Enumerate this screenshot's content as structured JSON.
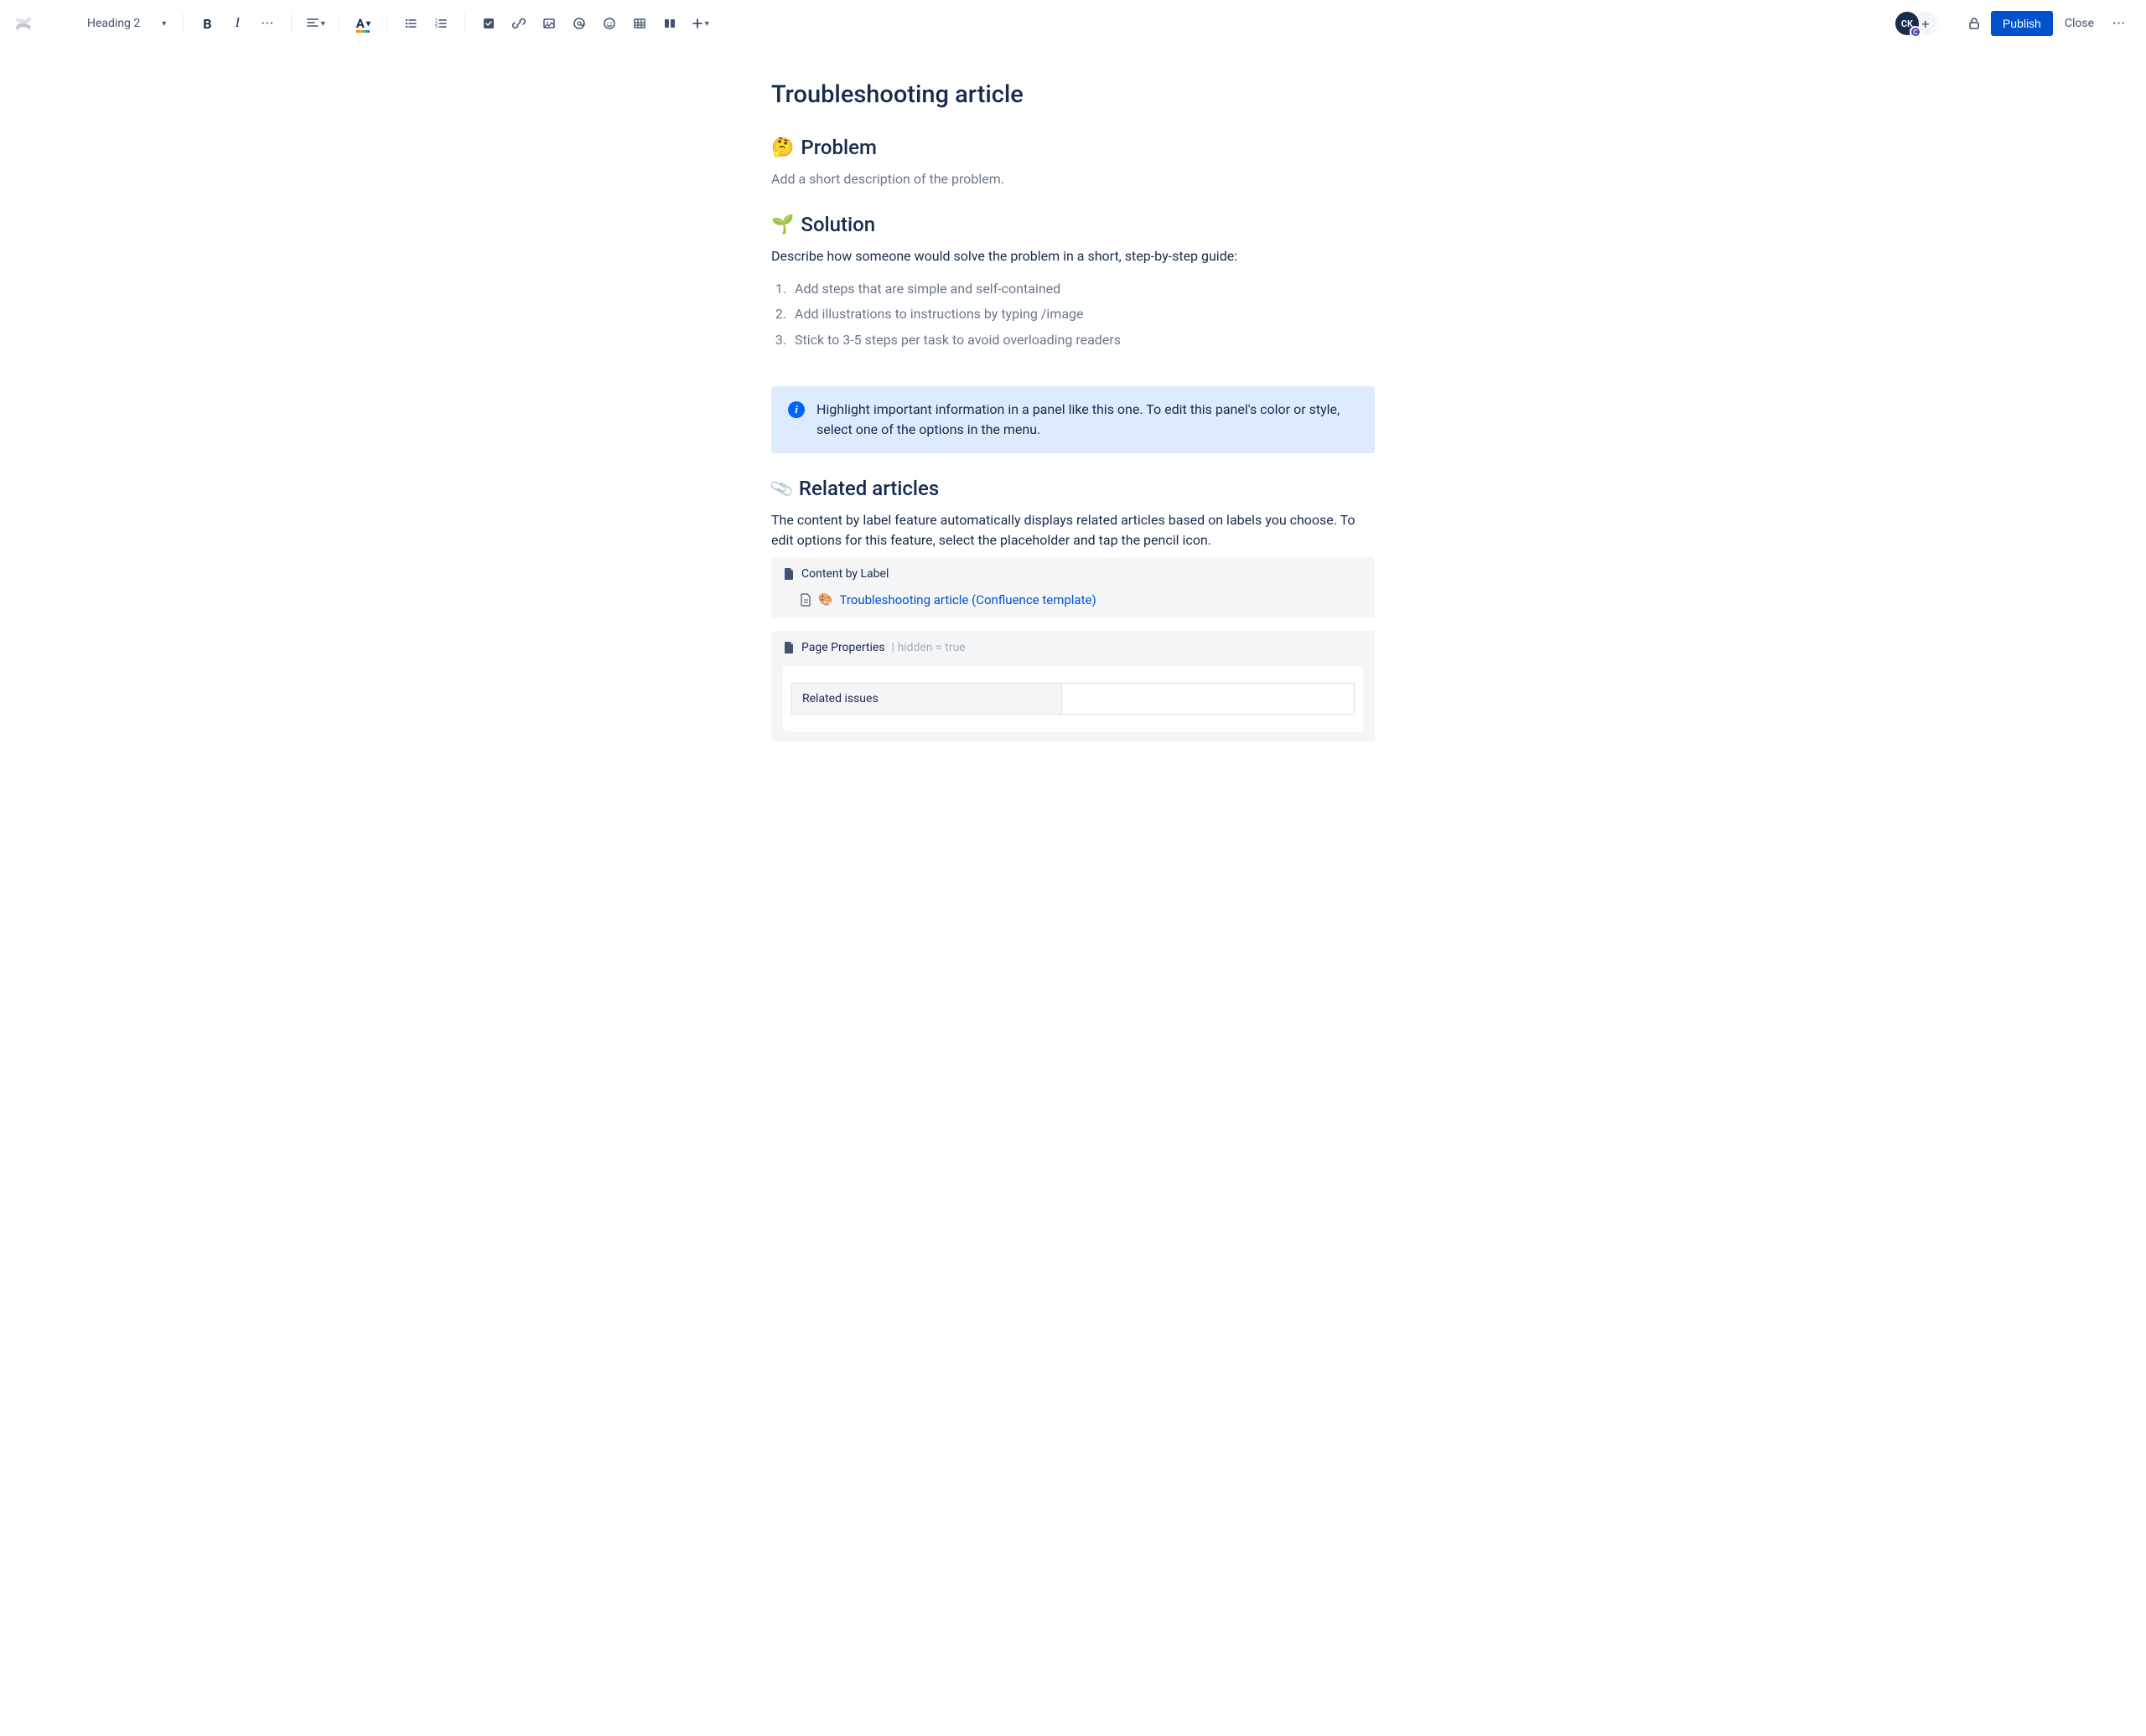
{
  "toolbar": {
    "heading_style": "Heading 2",
    "publish_label": "Publish",
    "close_label": "Close"
  },
  "user": {
    "initials": "CK",
    "badge": "C"
  },
  "page": {
    "title": "Troubleshooting article"
  },
  "sections": {
    "problem": {
      "emoji": "🤔",
      "heading": "Problem",
      "placeholder": "Add a short description of the problem."
    },
    "solution": {
      "emoji": "🌱",
      "heading": "Solution",
      "intro": "Describe how someone would solve the problem in a short, step-by-step guide:",
      "steps": [
        "Add steps that are simple and self-contained",
        "Add illustrations to instructions by typing /image",
        "Stick to 3-5 steps per task to avoid overloading readers"
      ]
    },
    "info_panel": "Highlight important information in a panel like this one. To edit this panel's color or style, select one of the options in the menu.",
    "related": {
      "emoji": "📎",
      "heading": "Related articles",
      "description": "The content by label feature automatically displays related articles based on labels you choose. To edit options for this feature, select the placeholder and tap the pencil icon."
    }
  },
  "macros": {
    "content_by_label": {
      "title": "Content by Label",
      "link_emoji": "🎨",
      "link_text": "Troubleshooting article (Confluence template)"
    },
    "page_properties": {
      "title": "Page Properties",
      "meta": " | hidden = true",
      "row_label": "Related issues"
    }
  }
}
